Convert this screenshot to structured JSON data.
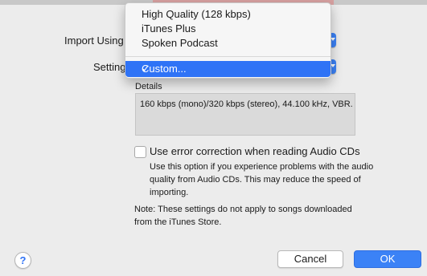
{
  "import_using": {
    "label": "Import Using"
  },
  "setting": {
    "label": "Setting"
  },
  "menu": {
    "items": [
      "High Quality (128 kbps)",
      "iTunes Plus",
      "Spoken Podcast"
    ],
    "selected": "Custom...",
    "checkmark": "✓"
  },
  "details": {
    "label": "Details",
    "text": "160 kbps (mono)/320 kbps (stereo), 44.100 kHz, VBR."
  },
  "error_correction": {
    "label": "Use error correction when reading Audio CDs",
    "checked": false,
    "help": "Use this option if you experience problems with the audio quality from Audio CDs.  This may reduce the speed of importing."
  },
  "note": "Note: These settings do not apply to songs downloaded from the iTunes Store.",
  "buttons": {
    "help": "?",
    "cancel": "Cancel",
    "ok": "OK"
  },
  "colors": {
    "accent": "#2f73f6",
    "background": "#ececec"
  }
}
